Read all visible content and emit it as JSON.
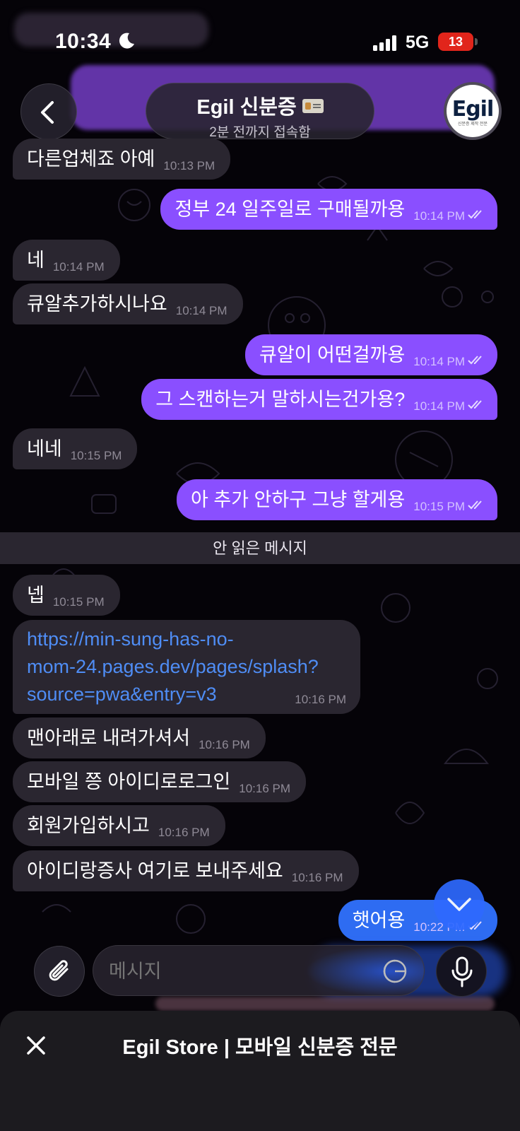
{
  "status_bar": {
    "time": "10:34",
    "network": "5G",
    "battery": "13"
  },
  "header": {
    "title": "Egil 신분증",
    "subtitle": "2분 전까지 접속함",
    "avatar_text": "Egil",
    "avatar_small": "신분증 제작 전문"
  },
  "messages": [
    {
      "side": "in",
      "text": "다른업체죠 아예",
      "time": "10:13 PM"
    },
    {
      "side": "out",
      "text": "정부 24 일주일로 구매될까용",
      "time": "10:14 PM"
    },
    {
      "side": "in",
      "text": "네",
      "time": "10:14 PM"
    },
    {
      "side": "in",
      "text": "큐알추가하시나요",
      "time": "10:14 PM"
    },
    {
      "side": "out",
      "text": "큐알이 어떤걸까용",
      "time": "10:14 PM"
    },
    {
      "side": "out",
      "text": "그 스캔하는거 말하시는건가용?",
      "time": "10:14 PM"
    },
    {
      "side": "in",
      "text": "네네",
      "time": "10:15 PM"
    },
    {
      "side": "out",
      "text": "아 추가 안하구 그냥 할게용",
      "time": "10:15 PM"
    },
    {
      "side": "in",
      "text": "넵",
      "time": "10:15 PM"
    },
    {
      "side": "in",
      "text": "https://min-sung-has-no-mom-24.pages.dev/pages/splash?source=pwa&entry=v3",
      "lines": [
        "https://min-sung-has-no-",
        "mom-24.pages.dev/pages/splash?",
        "source=pwa&entry=v3"
      ],
      "time": "10:16 PM"
    },
    {
      "side": "in",
      "text": "맨아래로 내려가셔서",
      "time": "10:16 PM"
    },
    {
      "side": "in",
      "text": "모바일 쯩 아이디로로그인",
      "time": "10:16 PM"
    },
    {
      "side": "in",
      "text": "회원가입하시고",
      "time": "10:16 PM"
    },
    {
      "side": "in",
      "text": "아이디랑증사 여기로 보내주세요",
      "time": "10:16 PM"
    },
    {
      "side": "out",
      "text": "햇어용",
      "time": "10:22 PM"
    }
  ],
  "unread_label": "안 읽은 메시지",
  "input": {
    "placeholder": "메시지"
  },
  "bottom_sheet": {
    "title": "Egil Store | 모바일 신분증 전문"
  },
  "colors": {
    "outgoing": "#8a4fff",
    "incoming": "#2a2630",
    "link": "#4f8df5",
    "scroll_button": "#2e69ff"
  },
  "icons": [
    "back-chevron-icon",
    "moon-icon",
    "signal-icon",
    "checkmarks-icon",
    "attach-icon",
    "sticker-icon",
    "mic-icon",
    "chevron-down-icon",
    "close-icon"
  ]
}
